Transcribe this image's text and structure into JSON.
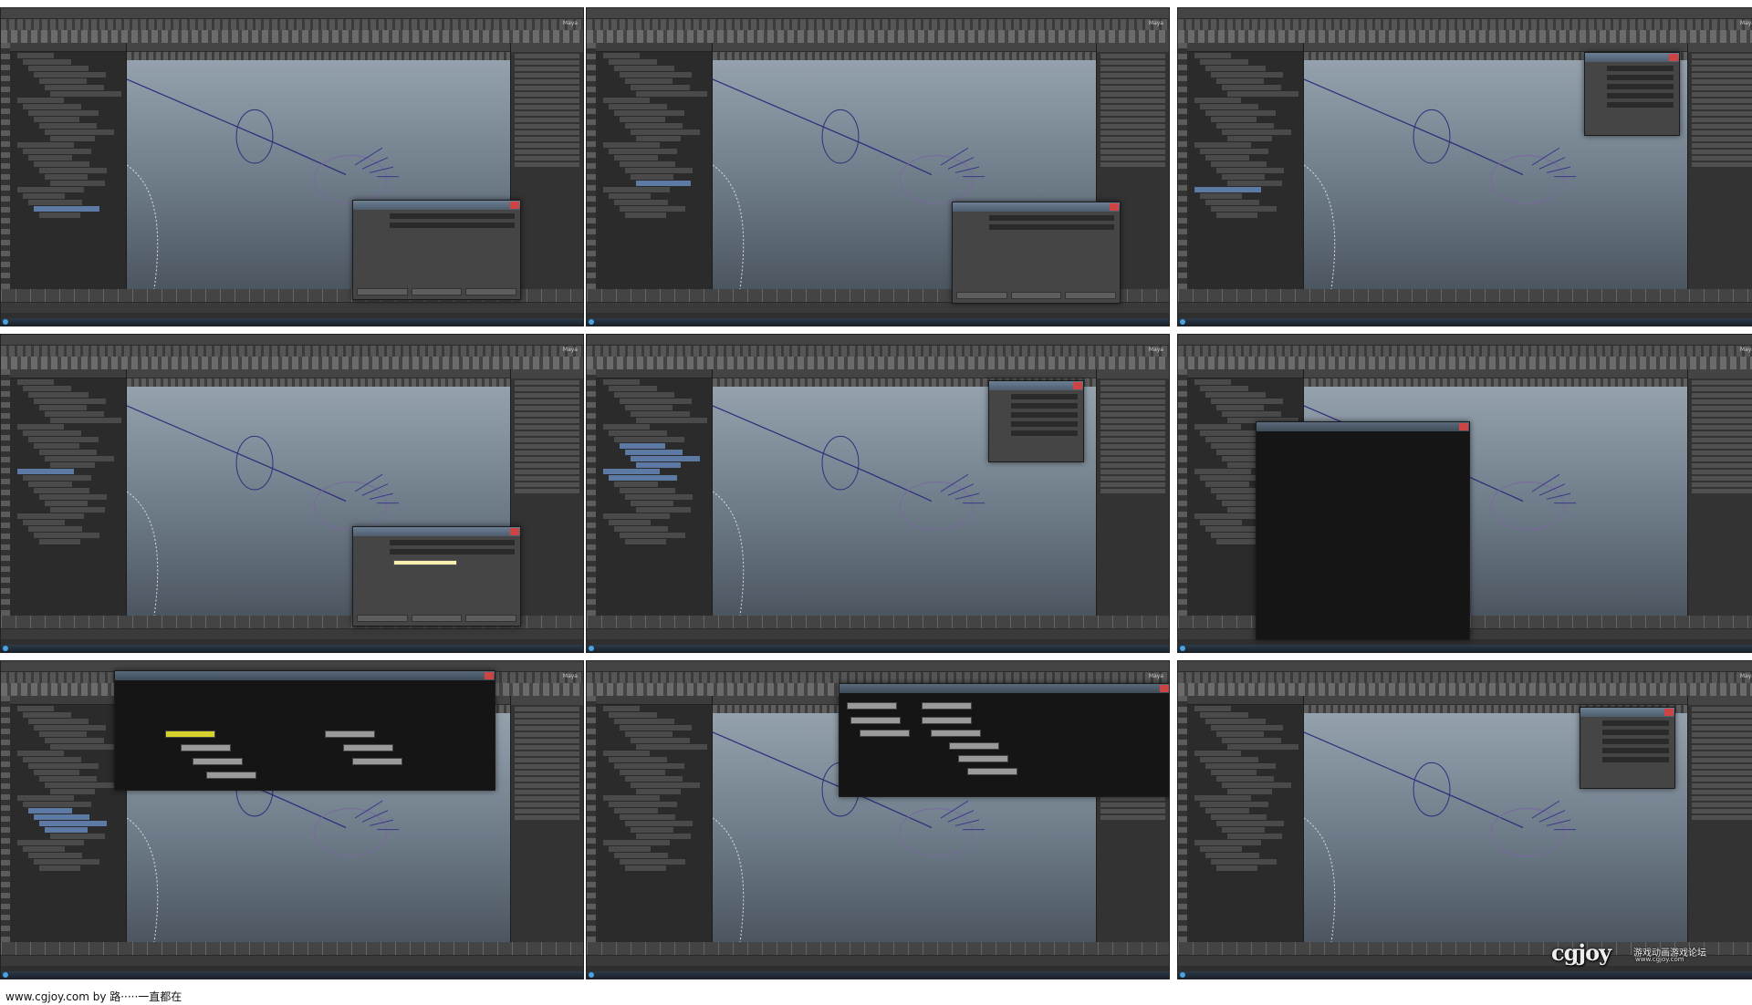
{
  "footer": {
    "caption": "www.cgjoy.com by 路·····一直都在"
  },
  "watermark": {
    "logo": "cgjoy",
    "tagline": "游戏动画游戏论坛",
    "url": "www.cgjoy.com"
  },
  "colors": {
    "viewport_top": "#9aa7b3",
    "viewport_bottom": "#4c5661",
    "selection": "#5c7aa3",
    "node_highlight": "#d8d22c",
    "wire": "#2f2f7a"
  },
  "app": {
    "shelf_label": "Maya"
  },
  "panels": [
    {
      "id": 1,
      "dialog": "search-replace"
    },
    {
      "id": 2,
      "dialog": "search-replace"
    },
    {
      "id": 3,
      "dialog": "tool-settings"
    },
    {
      "id": 4,
      "dialog": "search-replace-tool"
    },
    {
      "id": 5,
      "dialog": "tool-settings"
    },
    {
      "id": 6,
      "dialog": "hypergraph-empty"
    },
    {
      "id": 7,
      "dialog": "hypergraph-nodes"
    },
    {
      "id": 8,
      "dialog": "hypergraph-nodes-wide"
    },
    {
      "id": 9,
      "dialog": "tool-settings"
    }
  ]
}
